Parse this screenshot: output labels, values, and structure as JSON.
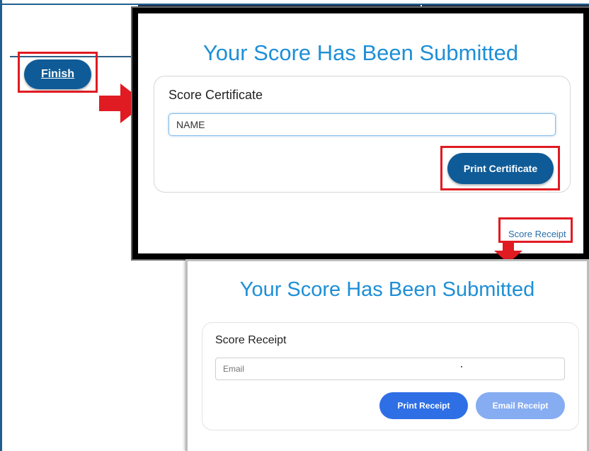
{
  "background_page": {
    "finish_button_label": "Finish"
  },
  "certificate_modal": {
    "title": "Your Score Has Been Submitted",
    "card_heading": "Score Certificate",
    "name_input_value": "NAME",
    "print_button_label": "Print Certificate",
    "score_receipt_link": "Score Receipt"
  },
  "receipt_modal": {
    "title": "Your Score Has Been Submitted",
    "card_heading": "Score Receipt",
    "email_placeholder": "Email",
    "print_button_label": "Print Receipt",
    "email_button_label": "Email Receipt"
  },
  "colors": {
    "highlight": "#e01b22",
    "title_blue": "#1e8fd6",
    "primary_button": "#0f5b97",
    "receipt_primary": "#2f6fe6",
    "receipt_secondary": "#86acf2"
  },
  "icons": {
    "arrow_to_certificate": "red-arrow-right-icon",
    "arrow_to_receipt": "red-arrow-down-icon"
  }
}
